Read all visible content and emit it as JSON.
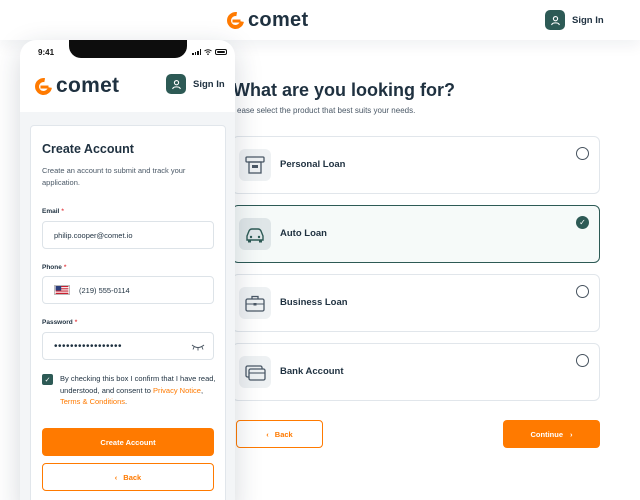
{
  "brand": {
    "name": "comet",
    "accent": "#ff7a00",
    "primary_dark": "#2d5a55"
  },
  "desktop": {
    "header": {
      "signin_label": "Sign In",
      "user_icon": "user-icon"
    },
    "title": "What are you looking for?",
    "subtitle": "ease select the product that best suits your needs.",
    "options": [
      {
        "label": "Personal Loan",
        "icon": "personal-loan-icon",
        "selected": false
      },
      {
        "label": "Auto Loan",
        "icon": "car-icon",
        "selected": true
      },
      {
        "label": "Business Loan",
        "icon": "briefcase-icon",
        "selected": false
      },
      {
        "label": "Bank Account",
        "icon": "wallet-icon",
        "selected": false
      }
    ],
    "back_label": "Back",
    "continue_label": "Continue"
  },
  "phone": {
    "status": {
      "time": "9:41"
    },
    "header": {
      "signin_label": "Sign In"
    },
    "form": {
      "title": "Create Account",
      "description": "Create an account to submit and track your application.",
      "email_label": "Email",
      "email_value": "philip.cooper@comet.io",
      "phone_label": "Phone",
      "phone_value": "(219) 555-0114",
      "password_label": "Password",
      "password_value": "•••••••••••••••••",
      "required_mark": "*",
      "consent_text": "By checking this box I confirm that I have read, understood, and consent to",
      "privacy_link": "Privacy Notice",
      "consent_sep": ", ",
      "terms_link": "Terms & Conditions",
      "consent_end": ".",
      "consent_checked": true,
      "create_label": "Create Account",
      "back_label": "Back"
    }
  }
}
